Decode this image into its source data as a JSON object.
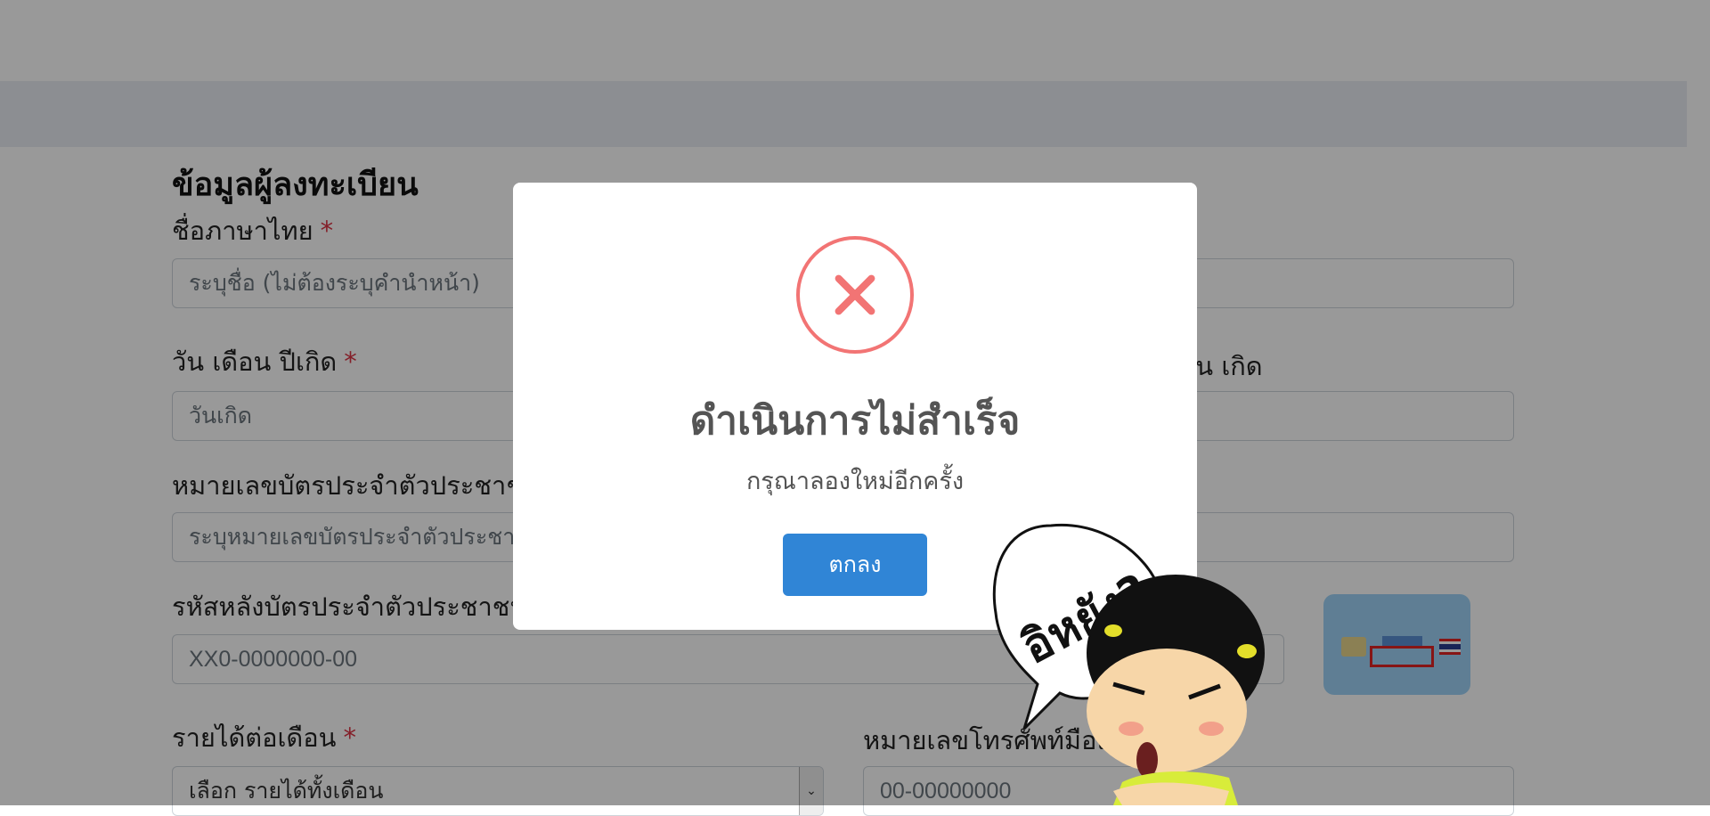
{
  "form": {
    "section_title": "ข้อมูลผู้ลงทะเบียน",
    "required_mark": "*",
    "thai_name": {
      "label": "ชื่อภาษาไทย",
      "placeholder": "ระบุชื่อ (ไม่ต้องระบุคำนำหน้า)"
    },
    "birth_date": {
      "label": "วัน เดือน ปีเกิด",
      "placeholder": "วันเกิด"
    },
    "birth_day_right_label": "วัน เกิด",
    "id_number": {
      "label": "หมายเลขบัตรประจำตัวประชาชน",
      "placeholder": "ระบุหมายเลขบัตรประจำตัวประชาชน"
    },
    "laser_code": {
      "label": "รหัสหลังบัตรประจำตัวประชาชน",
      "placeholder": "XX0-0000000-00"
    },
    "income": {
      "label": "รายได้ต่อเดือน",
      "selected": "เลือก รายได้ทั้งเดือน"
    },
    "phone": {
      "label": "หมายเลขโทรศัพท์มือถือ",
      "placeholder": "00-00000000"
    }
  },
  "dialog": {
    "title": "ดำเนินการไม่สำเร็จ",
    "message": "กรุณาลองใหม่อีกครั้ง",
    "ok_label": "ตกลง"
  },
  "sticker": {
    "text": "อิหยัง?"
  },
  "colors": {
    "error": "#f27474",
    "button": "#3085d6",
    "required": "#dc3545",
    "overlay": "rgba(0,0,0,0.4)"
  }
}
